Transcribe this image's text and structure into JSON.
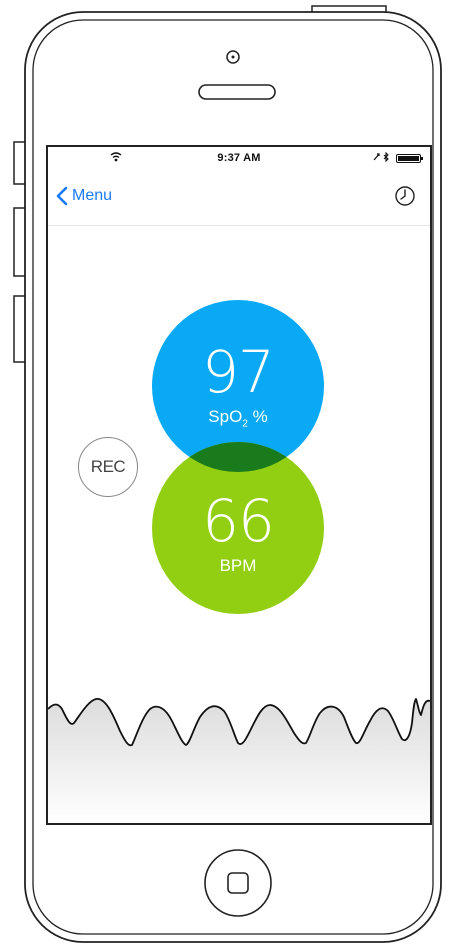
{
  "status_bar": {
    "time": "9:37 AM"
  },
  "nav": {
    "back_label": "Menu"
  },
  "readings": {
    "spo2": {
      "value": "97",
      "unit_main": "SpO",
      "unit_sub": "2",
      "unit_suffix": " %"
    },
    "bpm": {
      "value": "66",
      "unit": "BPM"
    }
  },
  "record": {
    "label": "REC"
  },
  "icons": {
    "back": "chevron-left-icon",
    "history": "clock-icon",
    "wifi": "wifi-icon",
    "bluetooth": "bluetooth-icon",
    "battery": "battery-icon",
    "home": "home-button-icon"
  },
  "colors": {
    "accent": "#1a7cf5",
    "spo2": "#0aa9f5",
    "bpm": "#92cf12",
    "overlap": "#1a7b1d"
  }
}
